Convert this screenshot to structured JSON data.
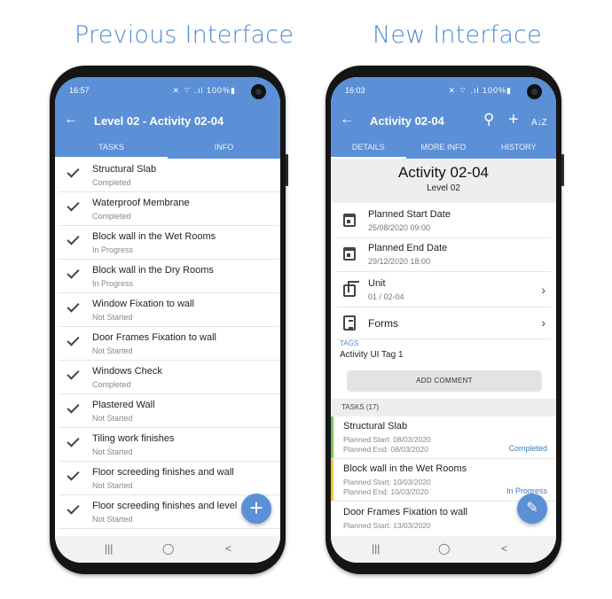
{
  "headings": {
    "left": "Previous Interface",
    "right": "New Interface"
  },
  "colors": {
    "accent": "#5b8fd6",
    "status_completed": "#7cc25a",
    "status_in_progress": "#f5c53a"
  },
  "left_phone": {
    "time": "16:57",
    "status_icons": "✕ ⌔ .ıl 100%▮",
    "title": "Level 02 - Activity 02-04",
    "tabs": [
      "TASKS",
      "INFO"
    ],
    "tasks": [
      {
        "name": "Structural Slab",
        "status": "Completed"
      },
      {
        "name": "Waterproof Membrane",
        "status": "Completed"
      },
      {
        "name": "Block wall in the Wet Rooms",
        "status": "In Progress"
      },
      {
        "name": "Block wall in the Dry Rooms",
        "status": "In Progress"
      },
      {
        "name": "Window Fixation to wall",
        "status": "Not Started"
      },
      {
        "name": "Door Frames Fixation to wall",
        "status": "Not Started"
      },
      {
        "name": "Windows Check",
        "status": "Completed"
      },
      {
        "name": "Plastered Wall",
        "status": "Not Started"
      },
      {
        "name": "Tiling work finishes",
        "status": "Not Started"
      },
      {
        "name": "Floor screeding finishes and wall",
        "status": "Not Started"
      },
      {
        "name": "Floor screeding finishes and level",
        "status": "Not Started"
      }
    ],
    "fab_icon": "plus-icon",
    "nav": {
      "recents": "|||",
      "home": "◯",
      "back": "<"
    }
  },
  "right_phone": {
    "time": "16:03",
    "status_icons": "✕ ⌔ .ıl 100%▮",
    "title": "Activity 02-04",
    "actions": {
      "search": "⚲",
      "add": "+",
      "sort": "A↓Z"
    },
    "tabs": [
      "DETAILS",
      "MORE INFO",
      "HISTORY"
    ],
    "activity_title": "Activity 02-04",
    "activity_level": "Level 02",
    "planned_start_label": "Planned Start Date",
    "planned_start_value": "25/08/2020 09:00",
    "planned_end_label": "Planned End Date",
    "planned_end_value": "29/12/2020 18:00",
    "unit_label": "Unit",
    "unit_value": "01 / 02-04",
    "forms_label": "Forms",
    "tags_label": "TAGS",
    "tags_value": "Activity UI Tag 1",
    "add_comment": "ADD COMMENT",
    "tasks_header": "TASKS (17)",
    "tasks": [
      {
        "name": "Structural Slab",
        "start": "Planned Start: 08/03/2020",
        "end": "Planned End: 08/03/2020",
        "status": "Completed"
      },
      {
        "name": "Block wall in the Wet Rooms",
        "start": "Planned Start: 10/03/2020",
        "end": "Planned End: 10/03/2020",
        "status": "In Progress"
      },
      {
        "name": "Door Frames Fixation to wall",
        "start": "Planned Start: 13/03/2020",
        "end": "",
        "status": ""
      }
    ],
    "fab_icon": "pencil-icon",
    "nav": {
      "recents": "|||",
      "home": "◯",
      "back": "<"
    }
  }
}
